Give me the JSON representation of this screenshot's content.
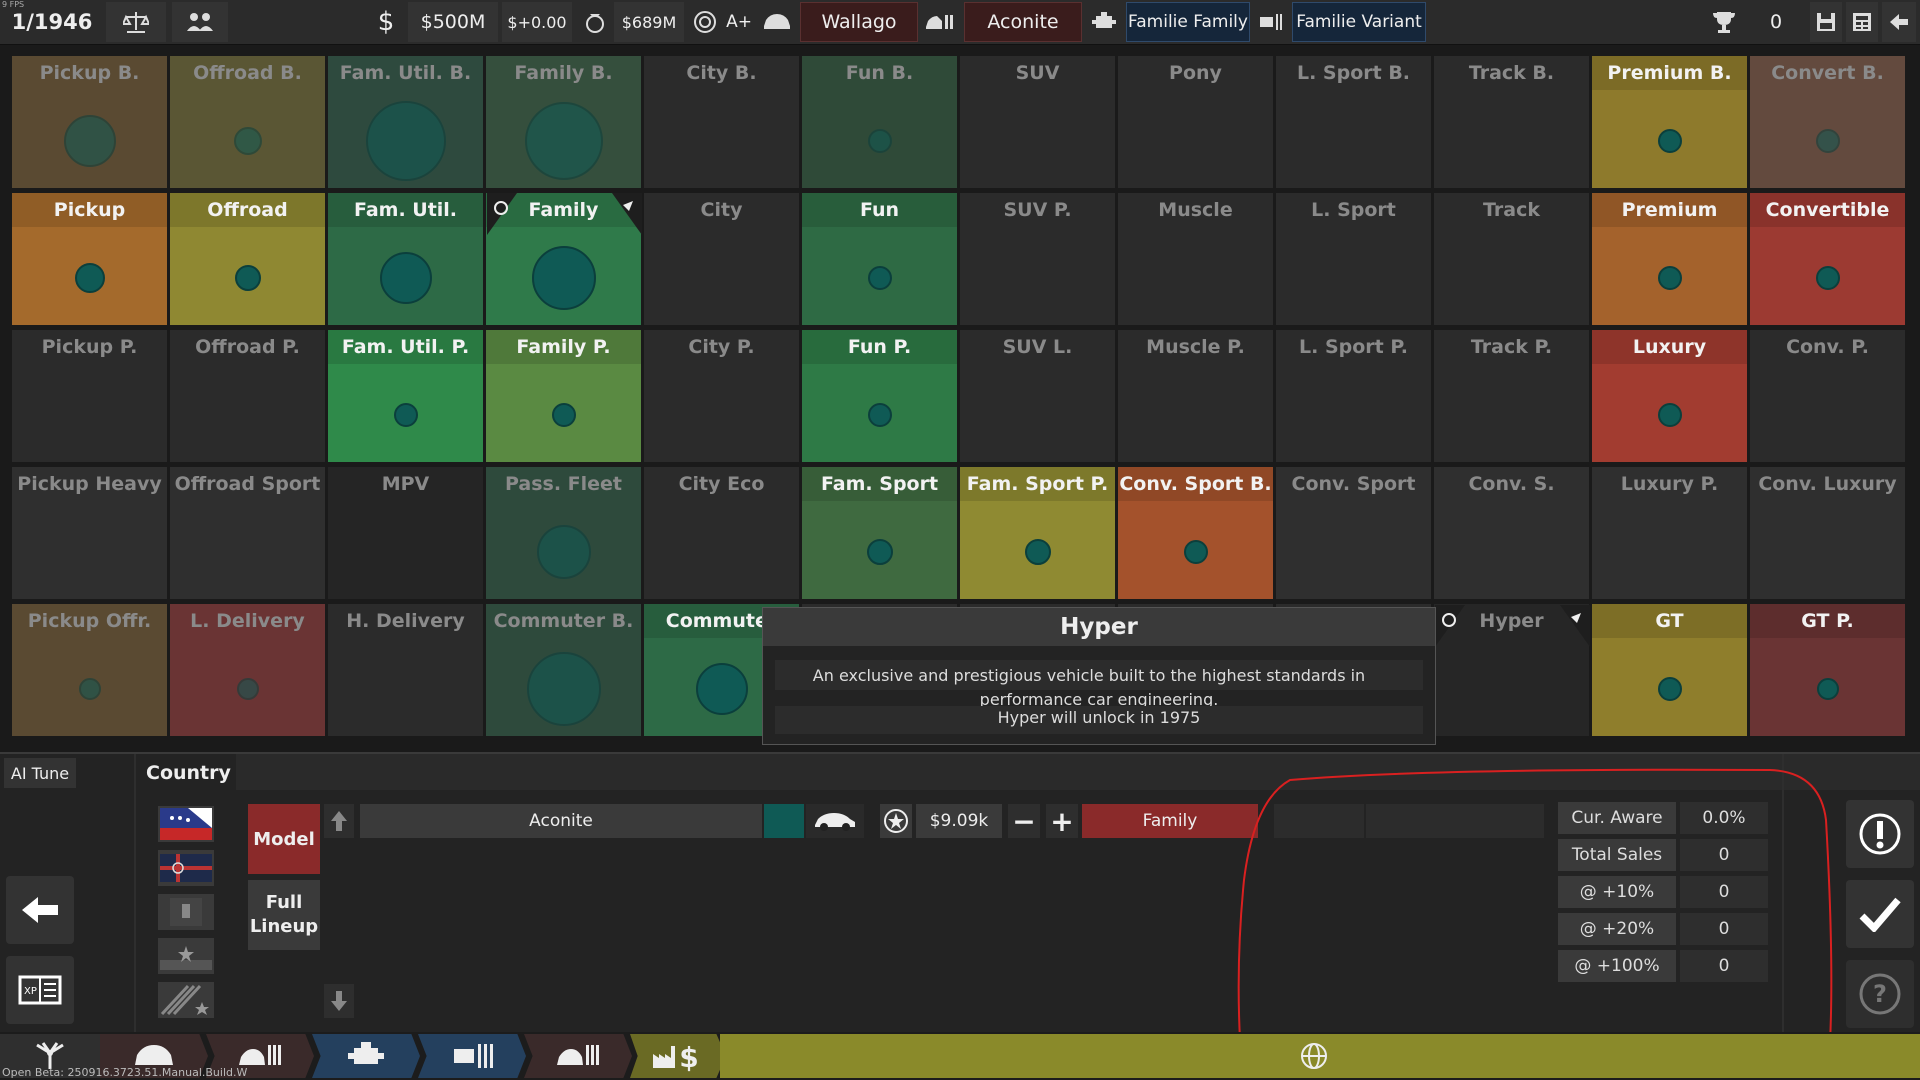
{
  "topbar": {
    "fps": "9 FPS",
    "date": "1/1946",
    "money": "$500M",
    "delta": "$+0.00",
    "value": "$689M",
    "rating": "A+",
    "company": "Wallago",
    "model": "Aconite",
    "family": "Familie Family",
    "variant": "Familie Variant",
    "trophies": "0"
  },
  "grid": {
    "rows": [
      [
        {
          "label": "Pickup B.",
          "bg": "#5a4a32",
          "active": false,
          "dot": 52
        },
        {
          "label": "Offroad B.",
          "bg": "#5a5634",
          "active": false,
          "dot": 28
        },
        {
          "label": "Fam. Util. B.",
          "bg": "#2e4a3e",
          "active": false,
          "dot": 80
        },
        {
          "label": "Family B.",
          "bg": "#354f3d",
          "active": false,
          "dot": 78
        },
        {
          "label": "City B.",
          "bg": "#2b2b2b",
          "active": false,
          "dot": 0
        },
        {
          "label": "Fun B.",
          "bg": "#2f4a38",
          "active": false,
          "dot": 24
        },
        {
          "label": "SUV",
          "bg": "#2b2b2b",
          "active": false,
          "dot": 0
        },
        {
          "label": "Pony",
          "bg": "#2b2b2b",
          "active": false,
          "dot": 0
        },
        {
          "label": "L. Sport B.",
          "bg": "#2b2b2b",
          "active": false,
          "dot": 0
        },
        {
          "label": "Track B.",
          "bg": "#2b2b2b",
          "active": false,
          "dot": 0
        },
        {
          "label": "Premium B.",
          "bg": "#8e7a2c",
          "active": true,
          "dot": 24
        },
        {
          "label": "Convert B.",
          "bg": "#634a3e",
          "active": false,
          "dot": 24
        }
      ],
      [
        {
          "label": "Pickup",
          "bg": "#a46a2c",
          "active": true,
          "dot": 30
        },
        {
          "label": "Offroad",
          "bg": "#8f8832",
          "active": true,
          "dot": 26
        },
        {
          "label": "Fam. Util.",
          "bg": "#2d6a46",
          "active": true,
          "dot": 52
        },
        {
          "label": "Family",
          "bg": "#2f7a4a",
          "active": true,
          "dot": 64
        },
        {
          "label": "City",
          "bg": "#2b2b2b",
          "active": false,
          "dot": 0
        },
        {
          "label": "Fun",
          "bg": "#2e6a44",
          "active": true,
          "dot": 24
        },
        {
          "label": "SUV P.",
          "bg": "#2b2b2b",
          "active": false,
          "dot": 0
        },
        {
          "label": "Muscle",
          "bg": "#2b2b2b",
          "active": false,
          "dot": 0
        },
        {
          "label": "L. Sport",
          "bg": "#2b2b2b",
          "active": false,
          "dot": 0
        },
        {
          "label": "Track",
          "bg": "#2b2b2b",
          "active": false,
          "dot": 0
        },
        {
          "label": "Premium",
          "bg": "#a4622c",
          "active": true,
          "dot": 24
        },
        {
          "label": "Convertible",
          "bg": "#9c3a32",
          "active": true,
          "dot": 24
        }
      ],
      [
        {
          "label": "Pickup P.",
          "bg": "#2b2b2b",
          "active": false,
          "dot": 0
        },
        {
          "label": "Offroad P.",
          "bg": "#2b2b2b",
          "active": false,
          "dot": 0
        },
        {
          "label": "Fam. Util. P.",
          "bg": "#2f8a4a",
          "active": true,
          "dot": 24
        },
        {
          "label": "Family P.",
          "bg": "#5a8a42",
          "active": true,
          "dot": 24
        },
        {
          "label": "City P.",
          "bg": "#2b2b2b",
          "active": false,
          "dot": 0
        },
        {
          "label": "Fun P.",
          "bg": "#2e7a46",
          "active": true,
          "dot": 24
        },
        {
          "label": "SUV L.",
          "bg": "#2b2b2b",
          "active": false,
          "dot": 0
        },
        {
          "label": "Muscle P.",
          "bg": "#2b2b2b",
          "active": false,
          "dot": 0
        },
        {
          "label": "L. Sport P.",
          "bg": "#2b2b2b",
          "active": false,
          "dot": 0
        },
        {
          "label": "Track P.",
          "bg": "#2b2b2b",
          "active": false,
          "dot": 0
        },
        {
          "label": "Luxury",
          "bg": "#a23c30",
          "active": true,
          "dot": 24
        },
        {
          "label": "Conv. P.",
          "bg": "#2b2b2b",
          "active": false,
          "dot": 0
        }
      ],
      [
        {
          "label": "Pickup Heavy",
          "bg": "#2f2f2f",
          "active": false,
          "dot": 0
        },
        {
          "label": "Offroad Sport",
          "bg": "#2f2f2f",
          "active": false,
          "dot": 0
        },
        {
          "label": "MPV",
          "bg": "#252525",
          "active": false,
          "dot": 0
        },
        {
          "label": "Pass. Fleet",
          "bg": "#2e4a3c",
          "active": false,
          "dot": 54
        },
        {
          "label": "City Eco",
          "bg": "#2b2b2b",
          "active": false,
          "dot": 0
        },
        {
          "label": "Fam. Sport",
          "bg": "#3f6a40",
          "active": true,
          "dot": 26
        },
        {
          "label": "Fam. Sport P.",
          "bg": "#8f8a32",
          "active": true,
          "dot": 26
        },
        {
          "label": "Conv. Sport B.",
          "bg": "#a4522c",
          "active": true,
          "dot": 24
        },
        {
          "label": "Conv. Sport",
          "bg": "#2f2f2f",
          "active": false,
          "dot": 0
        },
        {
          "label": "Conv. S.",
          "bg": "#2f2f2f",
          "active": false,
          "dot": 0
        },
        {
          "label": "Luxury P.",
          "bg": "#2f2f2f",
          "active": false,
          "dot": 0
        },
        {
          "label": "Conv. Luxury",
          "bg": "#2f2f2f",
          "active": false,
          "dot": 0
        }
      ],
      [
        {
          "label": "Pickup Offr.",
          "bg": "#5a4a32",
          "active": false,
          "dot": 22
        },
        {
          "label": "L. Delivery",
          "bg": "#6a3434",
          "active": false,
          "dot": 22
        },
        {
          "label": "H. Delivery",
          "bg": "#2b2b2b",
          "active": false,
          "dot": 0
        },
        {
          "label": "Commuter B.",
          "bg": "#2e4a3c",
          "active": false,
          "dot": 74
        },
        {
          "label": "Commuter",
          "bg": "#2d6a46",
          "active": true,
          "dot": 52
        },
        {
          "label": "",
          "bg": "#2b2b2b",
          "active": false,
          "dot": 0
        },
        {
          "label": "",
          "bg": "#2b2b2b",
          "active": false,
          "dot": 0
        },
        {
          "label": "",
          "bg": "#2b2b2b",
          "active": false,
          "dot": 0
        },
        {
          "label": "",
          "bg": "#2b2b2b",
          "active": false,
          "dot": 0
        },
        {
          "label": "Hyper",
          "bg": "#262626",
          "active": false,
          "dot": 0
        },
        {
          "label": "GT",
          "bg": "#8f7e2c",
          "active": true,
          "dot": 24
        },
        {
          "label": "GT P.",
          "bg": "#6a3434",
          "active": true,
          "dot": 22
        }
      ]
    ]
  },
  "tooltip": {
    "title": "Hyper",
    "desc_line1": "An exclusive and prestigious vehicle built to the highest standards in",
    "desc_line2": "performance car engineering.",
    "unlock": "Hyper will unlock in 1975"
  },
  "bottom": {
    "ai_tune": "AI Tune",
    "country": "Country",
    "model_btn": "Model",
    "full_lineup_line1": "Full",
    "full_lineup_line2": "Lineup",
    "row_model": "Aconite",
    "price": "$9.09k",
    "market": "Family",
    "stats": [
      {
        "label": "Cur. Aware",
        "value": "0.0%"
      },
      {
        "label": "Total Sales",
        "value": "0"
      },
      {
        "label": "@ +10%",
        "value": "0"
      },
      {
        "label": "@ +20%",
        "value": "0"
      },
      {
        "label": "@ +100%",
        "value": "0"
      }
    ]
  },
  "footer": {
    "beta": "Open Beta: 250916.3723.51.Manual.Build.W"
  },
  "colors": {
    "accent_red": "#d92020",
    "tab_olive": "#8a8a2a",
    "tab_blue": "#24405e"
  }
}
